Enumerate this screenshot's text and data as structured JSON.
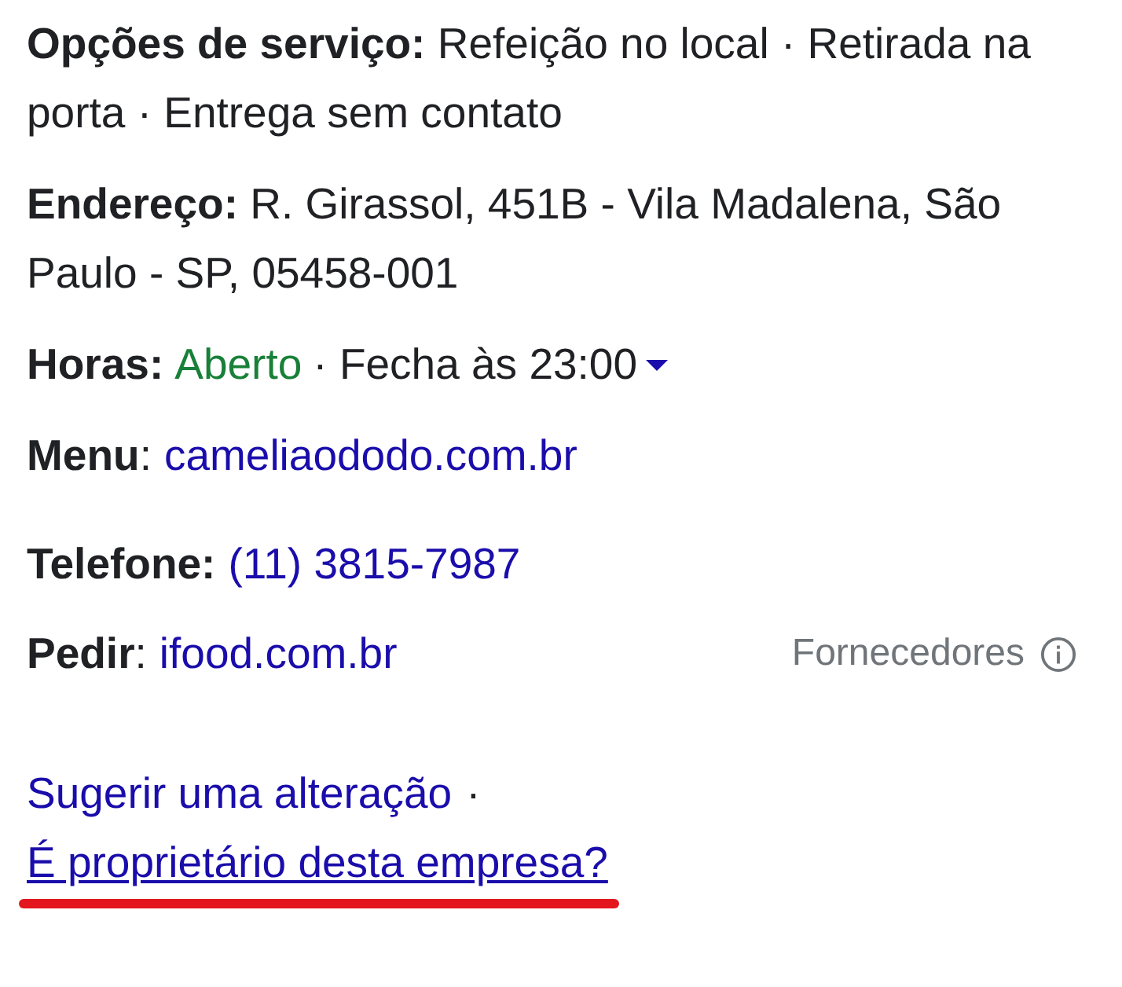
{
  "sections": [
    [
      {
        "kind": "text",
        "text": "**Opções de serviço:** Refeição no local · Retirada na porta · Entrega sem contato"
      },
      {
        "kind": "text",
        "text": "**Endereço:** R. Girassol, 451B - Vila Madalena, São Paulo - SP, 05458-001"
      },
      {
        "kind": "hours",
        "label": "Horas:",
        "status": "Aberto",
        "value": "· Fecha às 23:00"
      },
      {
        "kind": "link",
        "label": "**Menu**:",
        "link": "cameliaododo.com.br"
      }
    ],
    [
      {
        "kind": "link",
        "label": "**Telefone:**",
        "link": "(11) 3815-7987"
      },
      {
        "kind": "link",
        "label": "**Pedir**:",
        "link": "ifood.com.br",
        "aside": "Fornecedores"
      }
    ]
  ],
  "actions": {
    "suggest": "Sugerir uma alteração",
    "separator": "·",
    "owner": {
      "text": "É proprietário desta empresa?",
      "highlighted": true
    }
  }
}
